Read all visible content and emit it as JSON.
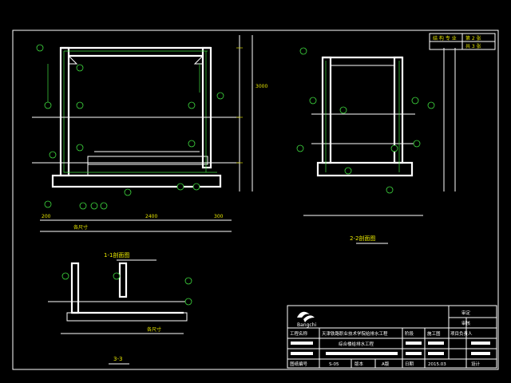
{
  "drawing": {
    "section_1_title": "1-1剖面图",
    "section_2_title": "2-2剖面图",
    "section_3_title": "3-3",
    "dim_left": "200",
    "dim_mid": "2400",
    "dim_right": "300",
    "dim_bottom": "各尺寸",
    "dim_right_side": "3000",
    "dim_3_3": "各尺寸"
  },
  "title_block": {
    "logo_text": "Bangchi",
    "project_name_label": "工程名称",
    "project_name_value": "天津铁路职业技术学院给排水工程",
    "drawing_name_value": "综合楼给排水工程",
    "drawing_no_label": "图纸编号",
    "drawing_no_value": "S-05",
    "version_label": "版本",
    "version_value": "A版",
    "date_label": "日期",
    "date_value": "2015.03",
    "stage_label": "阶段",
    "stage_value": "施工图",
    "design_label": "设计",
    "check_label": "审核",
    "approve_label": "审定",
    "project_lead_label": "项目负责人",
    "sheet_no": "第 2 张",
    "sheet_total": "共 3 张",
    "top_cell": "结 构 专 业"
  },
  "colors": {
    "background": "#000000",
    "lines": "#ffffff",
    "annotation": "#3fdc3f",
    "text": "#e6e600"
  }
}
